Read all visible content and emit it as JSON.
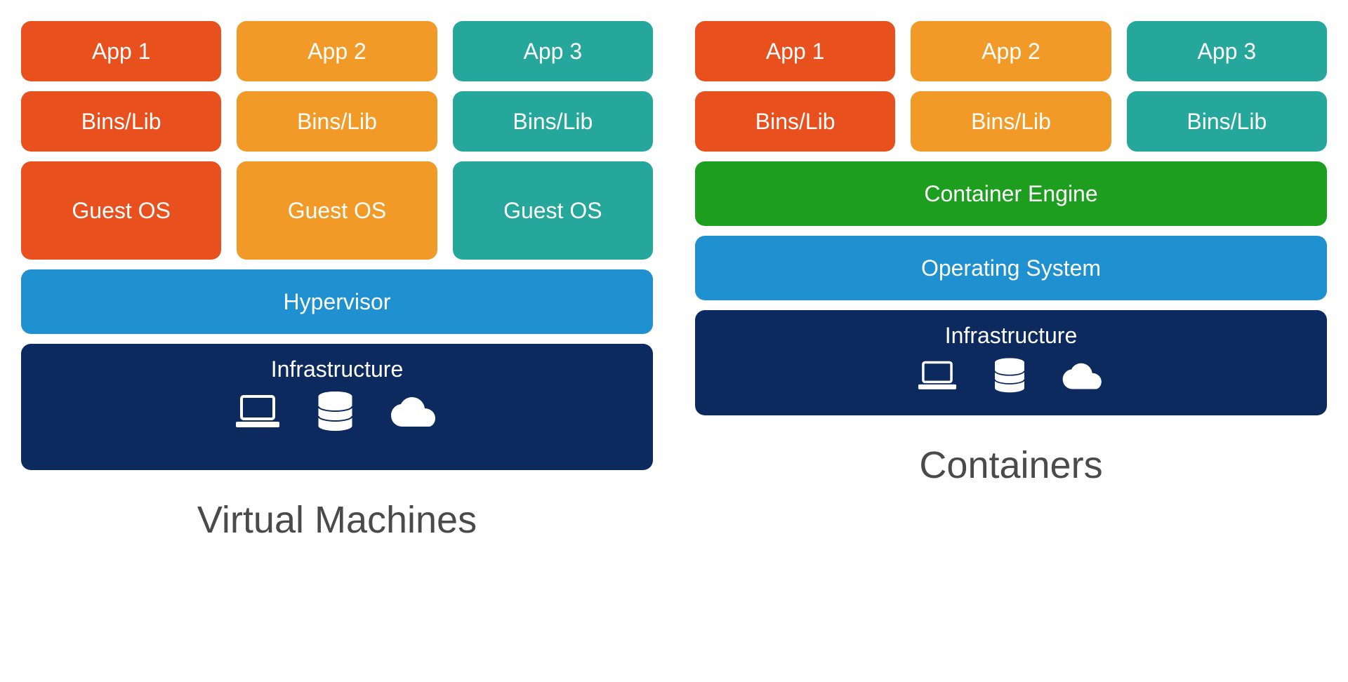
{
  "vm": {
    "caption": "Virtual Machines",
    "apps": [
      "App 1",
      "App 2",
      "App 3"
    ],
    "bins": [
      "Bins/Lib",
      "Bins/Lib",
      "Bins/Lib"
    ],
    "guest": [
      "Guest OS",
      "Guest OS",
      "Guest OS"
    ],
    "hypervisor": "Hypervisor",
    "infrastructure": "Infrastructure"
  },
  "ct": {
    "caption": "Containers",
    "apps": [
      "App 1",
      "App 2",
      "App 3"
    ],
    "bins": [
      "Bins/Lib",
      "Bins/Lib",
      "Bins/Lib"
    ],
    "engine": "Container Engine",
    "os": "Operating System",
    "infrastructure": "Infrastructure"
  },
  "colors": {
    "orange_dark": "#e8501d",
    "orange_mid": "#f19a27",
    "teal": "#26a79b",
    "green": "#1d9e1f",
    "blue_mid": "#1f91d0",
    "navy": "#0c2a5e"
  }
}
